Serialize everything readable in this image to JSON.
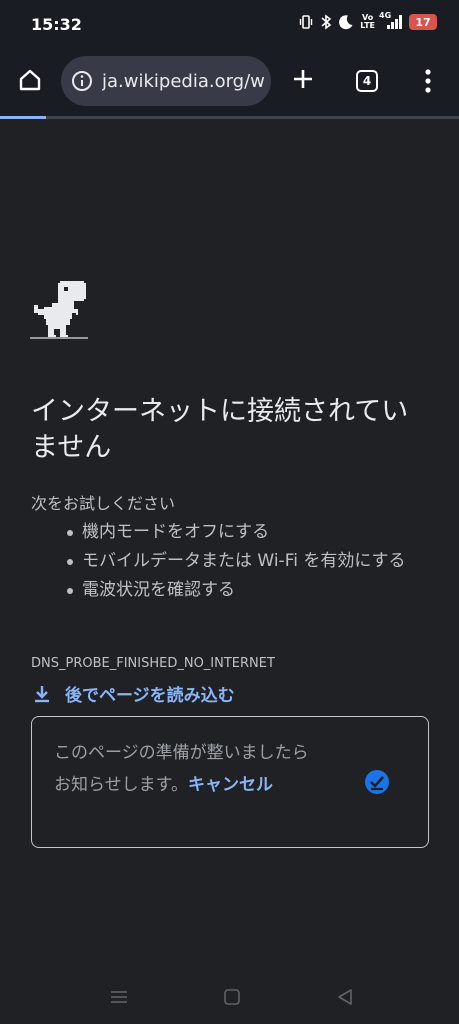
{
  "status_bar": {
    "time": "15:32",
    "network_label_top": "Vo",
    "network_label_bottom": "LTE",
    "signal_type": "4G",
    "battery_level": "17",
    "icons": [
      "vibrate-icon",
      "bluetooth-icon",
      "do-not-disturb-moon-icon",
      "volte-icon",
      "signal-4g-icon",
      "battery-icon"
    ],
    "battery_color": "#d9534f"
  },
  "toolbar": {
    "url": "ja.wikipedia.org/w",
    "tab_count": "4",
    "page_load_progress": 0.1
  },
  "error_page": {
    "heading": "インターネットに接続されていません",
    "suggestions_title": "次をお試しください",
    "suggestions": [
      "機内モードをオフにする",
      "モバイルデータまたは Wi-Fi を有効にする",
      "電波状況を確認する"
    ],
    "error_code": "DNS_PROBE_FINISHED_NO_INTERNET",
    "download_later_label": "後でページを読み込む",
    "notice_text": "このページの準備が整いましたらお知らせします。",
    "notice_cancel": "キャンセル"
  },
  "colors": {
    "background": "#202124",
    "accent": "#8ab4f8",
    "notice_icon": "#1a73e8"
  }
}
